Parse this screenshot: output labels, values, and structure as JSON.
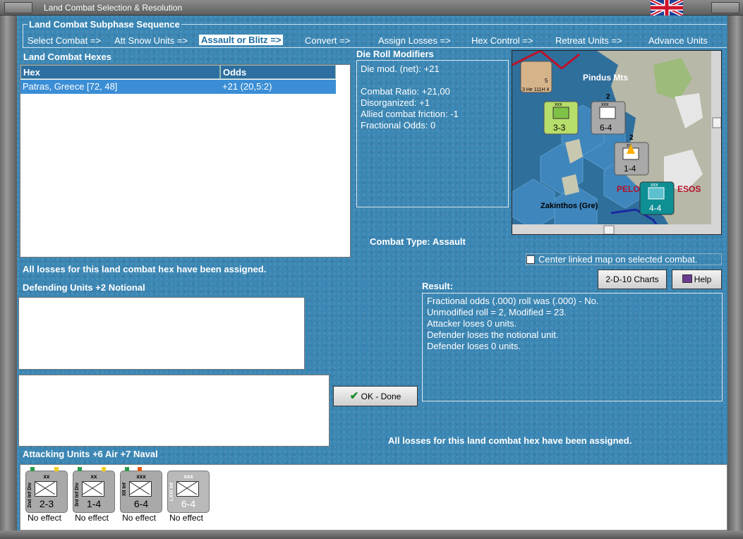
{
  "window": {
    "title": "Land Combat Selection & Resolution"
  },
  "subphase": {
    "title": "Land Combat Subphase Sequence",
    "steps": [
      "Select Combat =>",
      "Att Snow Units =>",
      "Assault or Blitz =>",
      "Convert =>",
      "Assign Losses =>",
      "Hex Control =>",
      "Retreat Units =>",
      "Advance Units"
    ]
  },
  "hexes": {
    "title": "Land Combat Hexes",
    "columns": [
      "Hex",
      "Odds"
    ],
    "rows": [
      {
        "hex": "Patras, Greece [72, 48]",
        "odds": "+21 (20,5:2)"
      }
    ]
  },
  "die_roll": {
    "title": "Die Roll Modifiers",
    "lines": [
      "Die mod. (net): +21",
      "",
      "Combat Ratio: +21,00",
      "Disorganized: +1",
      "Allied combat friction: -1",
      "Fractional Odds: 0"
    ]
  },
  "map": {
    "labels": [
      "Pindus Mts",
      "PELO",
      "ESOS",
      "Zakinthos (Gre)"
    ],
    "units": [
      {
        "type": "air",
        "label": "3 He 111H 4",
        "top": "5"
      },
      {
        "type": "inf",
        "size": "xxx",
        "strength": "3-3"
      },
      {
        "type": "inf",
        "size": "xxx",
        "strength": "6-4",
        "badge": "2"
      },
      {
        "type": "inf",
        "size": "xx",
        "strength": "1-4",
        "badge": "2"
      },
      {
        "type": "inf",
        "size": "xxx",
        "strength": "4-4"
      }
    ],
    "colors": {
      "sea": "#2f6f9c",
      "hex_sea": "#3f86bd",
      "land": "#b8b8a8",
      "snow": "#e6e6e6",
      "green": "#9dbb7a",
      "teal": "#0d8f94",
      "yellowgreen": "#b7dd6a"
    }
  },
  "combat_type": {
    "label": "Combat Type:",
    "value": "Assault"
  },
  "center_linked": {
    "label": "Center linked map on selected combat.",
    "checked": false
  },
  "buttons": {
    "charts": "2-D-10 Charts",
    "help": "Help",
    "ok": "OK - Done"
  },
  "losses_note": "All losses for this land combat hex have been assigned.",
  "defending": {
    "title": "Defending Units +2 Notional"
  },
  "result": {
    "title": "Result:",
    "lines": [
      "Fractional odds (.000) roll was (.000)  - No.",
      "Unmodified roll = 2, Modified = 23.",
      "Attacker loses 0 units.",
      "Defender loses the notional unit.",
      "Defender loses 0 units."
    ]
  },
  "attacking": {
    "title": "Attacking Units +6 Air +7 Naval",
    "units": [
      {
        "size": "xx",
        "label": "2nd Inf Div",
        "strength": "2-3",
        "effect": "No effect"
      },
      {
        "size": "xx",
        "label": "3rd Inf Div",
        "strength": "1-4",
        "effect": "No effect"
      },
      {
        "size": "xxx",
        "label": "XII Inf",
        "strength": "6-4",
        "effect": "No effect"
      },
      {
        "size": "xxx",
        "label": "LXXI Inf",
        "strength": "6-4",
        "effect": "No effect"
      }
    ]
  }
}
